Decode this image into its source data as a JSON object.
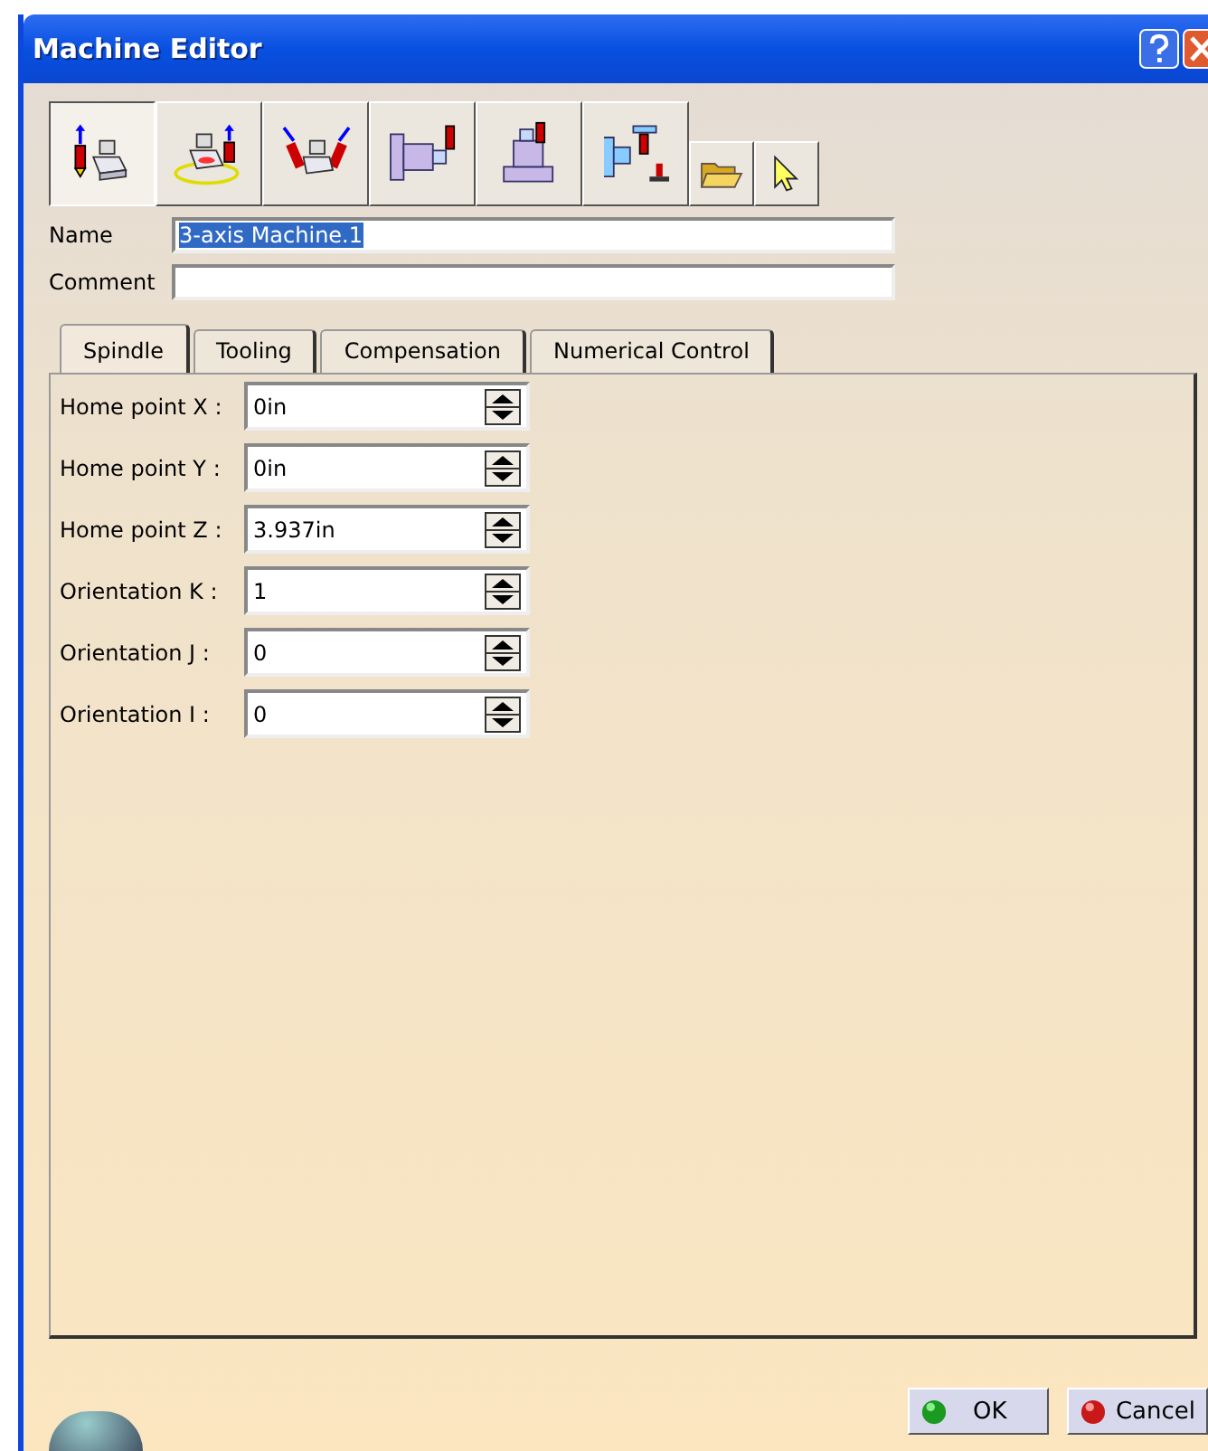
{
  "window": {
    "title": "Machine Editor"
  },
  "toolbar": [
    {
      "kind": "big",
      "selected": true
    },
    {
      "kind": "big",
      "selected": false
    },
    {
      "kind": "big",
      "selected": false
    },
    {
      "kind": "big",
      "selected": false
    },
    {
      "kind": "big",
      "selected": false
    },
    {
      "kind": "big",
      "selected": false
    },
    {
      "kind": "small",
      "selected": false
    },
    {
      "kind": "small",
      "selected": false
    }
  ],
  "fields": [
    {
      "label": "Name",
      "value": "3-axis Machine.1",
      "text_selected": true
    },
    {
      "label": "Comment"
    }
  ],
  "tabs": [
    {
      "label": "Spindle",
      "selected": true
    },
    {
      "label": "Tooling",
      "selected": false
    },
    {
      "label": "Compensation",
      "selected": false
    },
    {
      "label": "Numerical Control",
      "selected": false
    }
  ],
  "parameters": [
    {
      "label": "Home point X :",
      "value": "0in"
    },
    {
      "label": "Home point Y :",
      "value": "0in"
    },
    {
      "label": "Home point Z :",
      "value": "3.937in"
    },
    {
      "label": "Orientation K :",
      "value": "1"
    },
    {
      "label": "Orientation J :",
      "value": "0"
    },
    {
      "label": "Orientation I :",
      "value": "0"
    }
  ],
  "buttons": [
    {
      "kind": "ok",
      "label": "OK"
    },
    {
      "kind": "cancel",
      "label": "Cancel"
    }
  ]
}
